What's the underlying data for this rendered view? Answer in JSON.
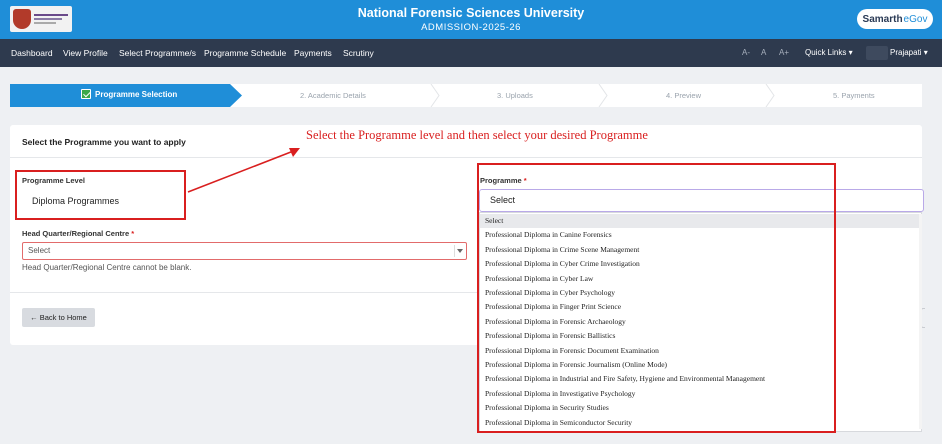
{
  "header": {
    "title": "National Forensic Sciences University",
    "subtitle": "ADMISSION-2025-26",
    "badge_main": "Samarth",
    "badge_accent": "eGov",
    "accent_color": "#1f8ed8"
  },
  "nav": {
    "items": [
      "Dashboard",
      "View Profile",
      "Select Programme/s",
      "Programme Schedule",
      "Payments",
      "Scrutiny"
    ],
    "font_sizes": [
      "A-",
      "A",
      "A+"
    ],
    "quick_links": "Quick Links ▾",
    "user": "Prajapati ▾"
  },
  "steps": [
    "Programme Selection",
    "2. Academic Details",
    "3. Uploads",
    "4. Preview",
    "5. Payments"
  ],
  "card": {
    "heading": "Select the Programme you want to apply"
  },
  "annotation": "Select the Programme level and then select your desired Programme",
  "form": {
    "level_label": "Programme Level",
    "level_value": "Diploma Programmes",
    "hq_label": "Head Quarter/Regional Centre",
    "hq_required": "*",
    "hq_value": "Select",
    "hq_error": "Head Quarter/Regional Centre cannot be blank.",
    "programme_label": "Programme",
    "programme_required": "*",
    "programme_value": "Select"
  },
  "back_button": "← Back to Home",
  "dropdown_options": [
    "Select",
    "Professional Diploma in Canine Forensics",
    "Professional Diploma in Crime Scene Management",
    "Professional Diploma in Cyber Crime Investigation",
    "Professional Diploma in Cyber Law",
    "Professional Diploma in Cyber Psychology",
    "Professional Diploma in Finger Print Science",
    "Professional Diploma in Forensic Archaeology",
    "Professional Diploma in Forensic Ballistics",
    "Professional Diploma in Forensic Document Examination",
    "Professional Diploma in Forensic Journalism (Online Mode)",
    "Professional Diploma in Industrial and Fire Safety, Hygiene and Environmental Management",
    "Professional Diploma in Investigative Psychology",
    "Professional Diploma in Security Studies",
    "Professional Diploma in Semiconductor Security"
  ]
}
